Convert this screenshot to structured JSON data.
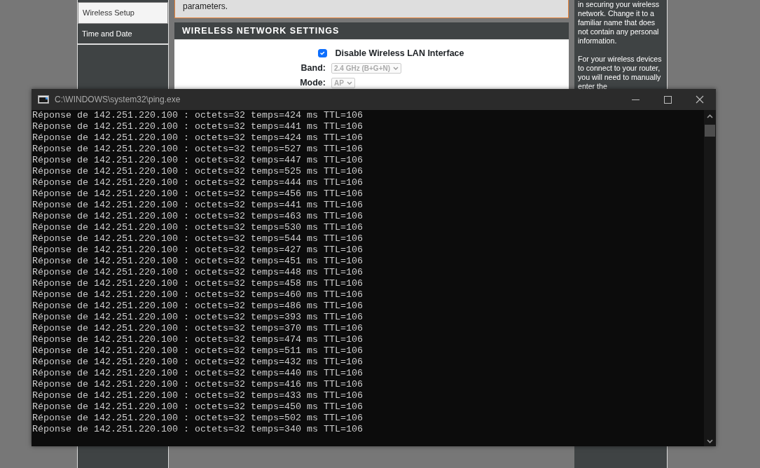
{
  "router_page": {
    "sidebar": {
      "items": [
        {
          "label": "Wireless Setup",
          "selected": true
        },
        {
          "label": "Time and Date",
          "selected": false
        }
      ]
    },
    "intro_text": "parameters.",
    "section": {
      "title": "WIRELESS NETWORK SETTINGS",
      "disable_checkbox": {
        "label": "Disable Wireless LAN Interface",
        "checked": true
      },
      "fields": [
        {
          "label": "Band:",
          "value": "2.4 GHz (B+G+N)",
          "disabled": true
        },
        {
          "label": "Mode:",
          "value": "AP",
          "disabled": true
        }
      ]
    },
    "help_paragraphs": [
      "in securing your wireless network. Change it to a familiar name that does not contain any personal information.",
      "For your wireless devices to connect to your router, you will need to manually enter the"
    ]
  },
  "console": {
    "title": "C:\\WINDOWS\\system32\\ping.exe",
    "lines": [
      "Réponse de 142.251.220.100 : octets=32 temps=424 ms TTL=106",
      "Réponse de 142.251.220.100 : octets=32 temps=441 ms TTL=106",
      "Réponse de 142.251.220.100 : octets=32 temps=424 ms TTL=106",
      "Réponse de 142.251.220.100 : octets=32 temps=527 ms TTL=106",
      "Réponse de 142.251.220.100 : octets=32 temps=447 ms TTL=106",
      "Réponse de 142.251.220.100 : octets=32 temps=525 ms TTL=106",
      "Réponse de 142.251.220.100 : octets=32 temps=444 ms TTL=106",
      "Réponse de 142.251.220.100 : octets=32 temps=456 ms TTL=106",
      "Réponse de 142.251.220.100 : octets=32 temps=441 ms TTL=106",
      "Réponse de 142.251.220.100 : octets=32 temps=463 ms TTL=106",
      "Réponse de 142.251.220.100 : octets=32 temps=530 ms TTL=106",
      "Réponse de 142.251.220.100 : octets=32 temps=544 ms TTL=106",
      "Réponse de 142.251.220.100 : octets=32 temps=427 ms TTL=106",
      "Réponse de 142.251.220.100 : octets=32 temps=451 ms TTL=106",
      "Réponse de 142.251.220.100 : octets=32 temps=448 ms TTL=106",
      "Réponse de 142.251.220.100 : octets=32 temps=458 ms TTL=106",
      "Réponse de 142.251.220.100 : octets=32 temps=460 ms TTL=106",
      "Réponse de 142.251.220.100 : octets=32 temps=486 ms TTL=106",
      "Réponse de 142.251.220.100 : octets=32 temps=393 ms TTL=106",
      "Réponse de 142.251.220.100 : octets=32 temps=370 ms TTL=106",
      "Réponse de 142.251.220.100 : octets=32 temps=474 ms TTL=106",
      "Réponse de 142.251.220.100 : octets=32 temps=511 ms TTL=106",
      "Réponse de 142.251.220.100 : octets=32 temps=432 ms TTL=106",
      "Réponse de 142.251.220.100 : octets=32 temps=440 ms TTL=106",
      "Réponse de 142.251.220.100 : octets=32 temps=416 ms TTL=106",
      "Réponse de 142.251.220.100 : octets=32 temps=433 ms TTL=106",
      "Réponse de 142.251.220.100 : octets=32 temps=450 ms TTL=106",
      "Réponse de 142.251.220.100 : octets=32 temps=502 ms TTL=106",
      "Réponse de 142.251.220.100 : octets=32 temps=340 ms TTL=106"
    ]
  }
}
